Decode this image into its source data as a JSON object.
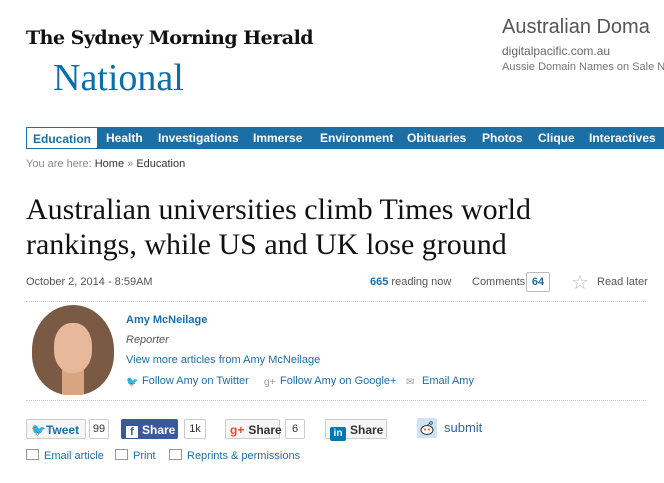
{
  "header": {
    "masthead": "The Sydney Morning Herald",
    "section": "National"
  },
  "ad": {
    "title": "Australian Doma",
    "url": "digitalpacific.com.au",
    "description": "Aussie Domain Names on Sale N"
  },
  "nav": {
    "items": [
      "Education",
      "Health",
      "Investigations",
      "Immerse",
      "Environment",
      "Obituaries",
      "Photos",
      "Clique",
      "Interactives"
    ],
    "active": "Education"
  },
  "breadcrumb": {
    "prefix": "You are here:",
    "home": "Home",
    "separator": "»",
    "current": "Education"
  },
  "article": {
    "headline": "Australian universities climb Times world rankings, while US and UK lose ground",
    "date": "October 2, 2014 - 8:59AM",
    "reading_count": "665",
    "reading_label": "reading now",
    "comments_label": "Comments",
    "comments_count": "64",
    "read_later_label": "Read later"
  },
  "author": {
    "name": "Amy McNeilage",
    "role": "Reporter",
    "more_link": "View more articles from Amy McNeilage",
    "follow_twitter": "Follow Amy on Twitter",
    "follow_google": "Follow Amy on Google+",
    "email": "Email Amy"
  },
  "share": {
    "tweet_label": "Tweet",
    "tweet_count": "99",
    "facebook_label": "Share",
    "facebook_count": "1k",
    "gplus_label": "Share",
    "gplus_count": "6",
    "linkedin_label": "Share",
    "reddit_label": "submit"
  },
  "tools": {
    "email_article": "Email article",
    "print": "Print",
    "reprints": "Reprints & permissions"
  },
  "colors": {
    "accent": "#1b6fa5",
    "section_title": "#0a6ea8",
    "facebook": "#3b5998",
    "linkedin": "#0077b5"
  }
}
